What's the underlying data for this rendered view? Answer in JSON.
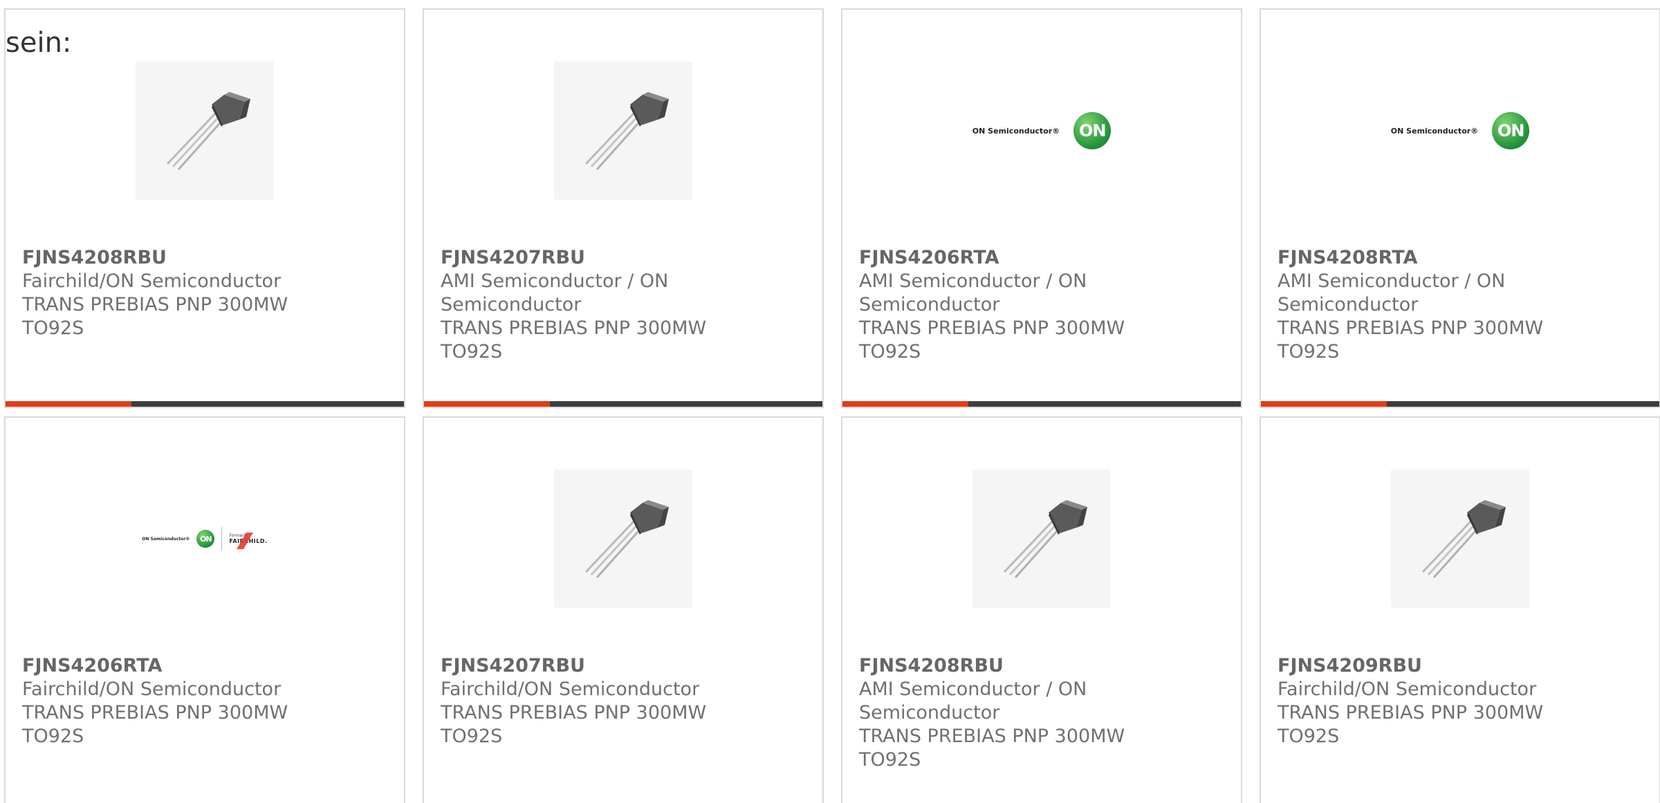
{
  "intro_text": "sein:",
  "colors": {
    "accent": "#e33c12",
    "bar": "#3d3d3d",
    "border": "#d9d9d9",
    "text": "#707070"
  },
  "cards": [
    {
      "part_number": "FJNS4208RBU",
      "manufacturer_lines": [
        "Fairchild/ON Semiconductor"
      ],
      "description_lines": [
        "TRANS PREBIAS PNP 300MW",
        "TO92S"
      ],
      "image": "transistor-to92s-icon"
    },
    {
      "part_number": "FJNS4207RBU",
      "manufacturer_lines": [
        "AMI Semiconductor / ON",
        "Semiconductor"
      ],
      "description_lines": [
        "TRANS PREBIAS PNP 300MW",
        "TO92S"
      ],
      "image": "transistor-to92s-icon"
    },
    {
      "part_number": "FJNS4206RTA",
      "manufacturer_lines": [
        "AMI Semiconductor / ON",
        "Semiconductor"
      ],
      "description_lines": [
        "TRANS PREBIAS PNP 300MW",
        "TO92S"
      ],
      "image": "on-semiconductor-logo",
      "logo_text": "ON Semiconductor®",
      "logo_mark": "ON"
    },
    {
      "part_number": "FJNS4208RTA",
      "manufacturer_lines": [
        "AMI Semiconductor / ON",
        "Semiconductor"
      ],
      "description_lines": [
        "TRANS PREBIAS PNP 300MW",
        "TO92S"
      ],
      "image": "on-semiconductor-logo",
      "logo_text": "ON Semiconductor®",
      "logo_mark": "ON"
    },
    {
      "part_number": "FJNS4206RTA",
      "manufacturer_lines": [
        "Fairchild/ON Semiconductor"
      ],
      "description_lines": [
        "TRANS PREBIAS PNP 300MW",
        "TO92S"
      ],
      "image": "on-fairchild-logo",
      "logo_text": "ON Semiconductor®",
      "logo_mark": "ON",
      "formerly_text": "Formerly",
      "fairchild_text": "FAIRCHILD."
    },
    {
      "part_number": "FJNS4207RBU",
      "manufacturer_lines": [
        "Fairchild/ON Semiconductor"
      ],
      "description_lines": [
        "TRANS PREBIAS PNP 300MW",
        "TO92S"
      ],
      "image": "transistor-to92s-icon"
    },
    {
      "part_number": "FJNS4208RBU",
      "manufacturer_lines": [
        "AMI Semiconductor / ON",
        "Semiconductor"
      ],
      "description_lines": [
        "TRANS PREBIAS PNP 300MW",
        "TO92S"
      ],
      "image": "transistor-to92s-icon"
    },
    {
      "part_number": "FJNS4209RBU",
      "manufacturer_lines": [
        "Fairchild/ON Semiconductor"
      ],
      "description_lines": [
        "TRANS PREBIAS PNP 300MW",
        "TO92S"
      ],
      "image": "transistor-to92s-icon"
    }
  ]
}
